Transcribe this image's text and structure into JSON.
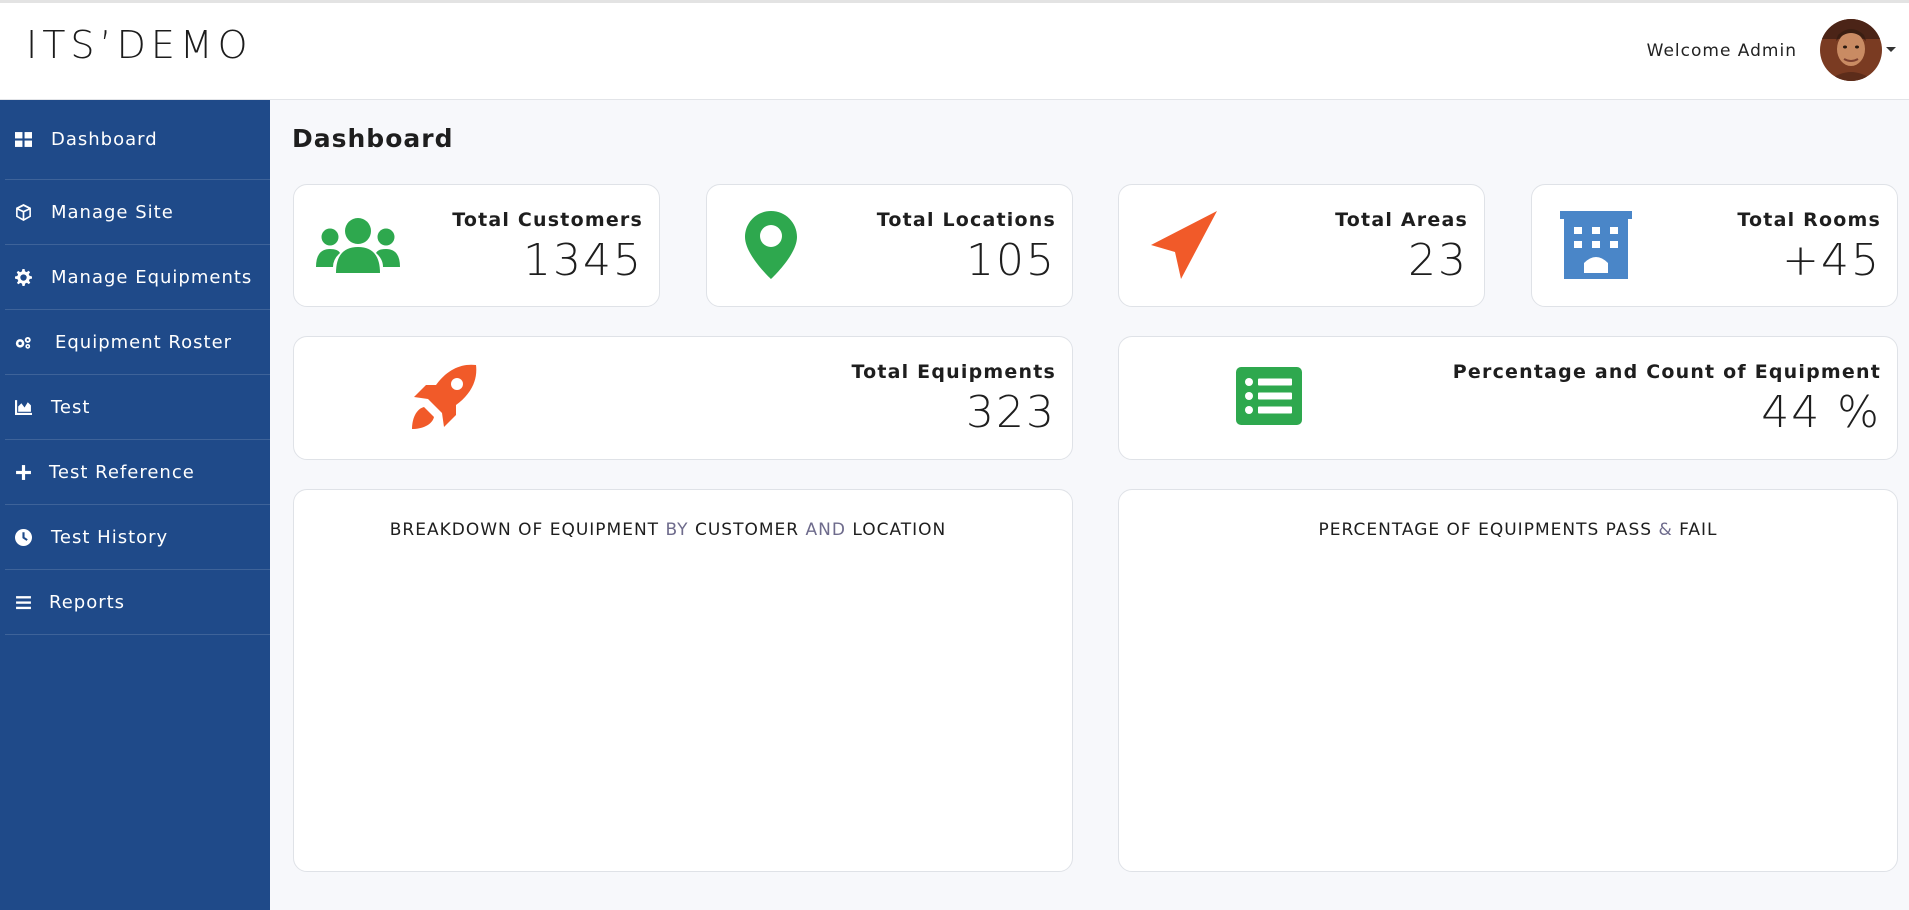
{
  "header": {
    "logo": "ITS’DEMO",
    "welcome": "Welcome Admin"
  },
  "sidebar": {
    "items": [
      {
        "label": "Dashboard",
        "icon": "grid-icon"
      },
      {
        "label": "Manage Site",
        "icon": "cube-icon"
      },
      {
        "label": "Manage Equipments",
        "icon": "gear-icon"
      },
      {
        "label": "Equipment Roster",
        "icon": "gears-icon"
      },
      {
        "label": "Test",
        "icon": "area-chart-icon"
      },
      {
        "label": "Test Reference",
        "icon": "plus-icon"
      },
      {
        "label": "Test History",
        "icon": "clock-icon"
      },
      {
        "label": "Reports",
        "icon": "list-icon"
      }
    ]
  },
  "page": {
    "title": "Dashboard"
  },
  "stats": {
    "customers": {
      "label": "Total Customers",
      "value": "1345",
      "icon": "users-icon",
      "color": "#2ea84e"
    },
    "locations": {
      "label": "Total Locations",
      "value": "105",
      "icon": "map-marker-icon",
      "color": "#2ea84e"
    },
    "areas": {
      "label": "Total Areas",
      "value": "23",
      "icon": "paper-plane-icon",
      "color": "#f15a29"
    },
    "rooms": {
      "label": "Total Rooms",
      "value": "+45",
      "icon": "building-icon",
      "color": "#4a86c8"
    },
    "equipments": {
      "label": "Total Equipments",
      "value": "323",
      "icon": "rocket-icon",
      "color": "#f15a29"
    },
    "percentage": {
      "label": "Percentage and Count of Equipment",
      "value": "44 %",
      "icon": "list-alt-icon",
      "color": "#2ea84e"
    }
  },
  "charts": {
    "breakdown": {
      "part1": "BREAKDOWN OF EQUIPMENT ",
      "by": "BY",
      "part2": " CUSTOMER ",
      "and": "AND",
      "part3": " LOCATION"
    },
    "passfail": {
      "part1": "PERCENTAGE OF EQUIPMENTS PASS ",
      "amp": "&",
      "part2": " FAIL"
    }
  },
  "colors": {
    "sidebar": "#1f4a89",
    "green": "#2ea84e",
    "orange": "#f15a29",
    "blue": "#4a86c8"
  }
}
